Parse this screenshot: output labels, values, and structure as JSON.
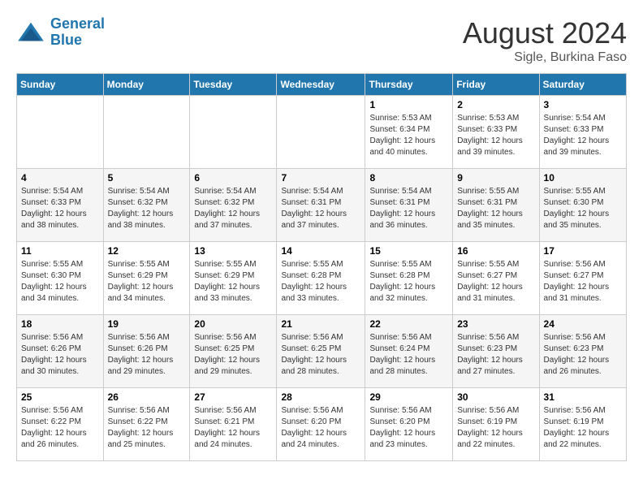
{
  "logo": {
    "line1": "General",
    "line2": "Blue"
  },
  "title": "August 2024",
  "subtitle": "Sigle, Burkina Faso",
  "weekdays": [
    "Sunday",
    "Monday",
    "Tuesday",
    "Wednesday",
    "Thursday",
    "Friday",
    "Saturday"
  ],
  "weeks": [
    [
      {
        "day": "",
        "info": ""
      },
      {
        "day": "",
        "info": ""
      },
      {
        "day": "",
        "info": ""
      },
      {
        "day": "",
        "info": ""
      },
      {
        "day": "1",
        "info": "Sunrise: 5:53 AM\nSunset: 6:34 PM\nDaylight: 12 hours\nand 40 minutes."
      },
      {
        "day": "2",
        "info": "Sunrise: 5:53 AM\nSunset: 6:33 PM\nDaylight: 12 hours\nand 39 minutes."
      },
      {
        "day": "3",
        "info": "Sunrise: 5:54 AM\nSunset: 6:33 PM\nDaylight: 12 hours\nand 39 minutes."
      }
    ],
    [
      {
        "day": "4",
        "info": "Sunrise: 5:54 AM\nSunset: 6:33 PM\nDaylight: 12 hours\nand 38 minutes."
      },
      {
        "day": "5",
        "info": "Sunrise: 5:54 AM\nSunset: 6:32 PM\nDaylight: 12 hours\nand 38 minutes."
      },
      {
        "day": "6",
        "info": "Sunrise: 5:54 AM\nSunset: 6:32 PM\nDaylight: 12 hours\nand 37 minutes."
      },
      {
        "day": "7",
        "info": "Sunrise: 5:54 AM\nSunset: 6:31 PM\nDaylight: 12 hours\nand 37 minutes."
      },
      {
        "day": "8",
        "info": "Sunrise: 5:54 AM\nSunset: 6:31 PM\nDaylight: 12 hours\nand 36 minutes."
      },
      {
        "day": "9",
        "info": "Sunrise: 5:55 AM\nSunset: 6:31 PM\nDaylight: 12 hours\nand 35 minutes."
      },
      {
        "day": "10",
        "info": "Sunrise: 5:55 AM\nSunset: 6:30 PM\nDaylight: 12 hours\nand 35 minutes."
      }
    ],
    [
      {
        "day": "11",
        "info": "Sunrise: 5:55 AM\nSunset: 6:30 PM\nDaylight: 12 hours\nand 34 minutes."
      },
      {
        "day": "12",
        "info": "Sunrise: 5:55 AM\nSunset: 6:29 PM\nDaylight: 12 hours\nand 34 minutes."
      },
      {
        "day": "13",
        "info": "Sunrise: 5:55 AM\nSunset: 6:29 PM\nDaylight: 12 hours\nand 33 minutes."
      },
      {
        "day": "14",
        "info": "Sunrise: 5:55 AM\nSunset: 6:28 PM\nDaylight: 12 hours\nand 33 minutes."
      },
      {
        "day": "15",
        "info": "Sunrise: 5:55 AM\nSunset: 6:28 PM\nDaylight: 12 hours\nand 32 minutes."
      },
      {
        "day": "16",
        "info": "Sunrise: 5:55 AM\nSunset: 6:27 PM\nDaylight: 12 hours\nand 31 minutes."
      },
      {
        "day": "17",
        "info": "Sunrise: 5:56 AM\nSunset: 6:27 PM\nDaylight: 12 hours\nand 31 minutes."
      }
    ],
    [
      {
        "day": "18",
        "info": "Sunrise: 5:56 AM\nSunset: 6:26 PM\nDaylight: 12 hours\nand 30 minutes."
      },
      {
        "day": "19",
        "info": "Sunrise: 5:56 AM\nSunset: 6:26 PM\nDaylight: 12 hours\nand 29 minutes."
      },
      {
        "day": "20",
        "info": "Sunrise: 5:56 AM\nSunset: 6:25 PM\nDaylight: 12 hours\nand 29 minutes."
      },
      {
        "day": "21",
        "info": "Sunrise: 5:56 AM\nSunset: 6:25 PM\nDaylight: 12 hours\nand 28 minutes."
      },
      {
        "day": "22",
        "info": "Sunrise: 5:56 AM\nSunset: 6:24 PM\nDaylight: 12 hours\nand 28 minutes."
      },
      {
        "day": "23",
        "info": "Sunrise: 5:56 AM\nSunset: 6:23 PM\nDaylight: 12 hours\nand 27 minutes."
      },
      {
        "day": "24",
        "info": "Sunrise: 5:56 AM\nSunset: 6:23 PM\nDaylight: 12 hours\nand 26 minutes."
      }
    ],
    [
      {
        "day": "25",
        "info": "Sunrise: 5:56 AM\nSunset: 6:22 PM\nDaylight: 12 hours\nand 26 minutes."
      },
      {
        "day": "26",
        "info": "Sunrise: 5:56 AM\nSunset: 6:22 PM\nDaylight: 12 hours\nand 25 minutes."
      },
      {
        "day": "27",
        "info": "Sunrise: 5:56 AM\nSunset: 6:21 PM\nDaylight: 12 hours\nand 24 minutes."
      },
      {
        "day": "28",
        "info": "Sunrise: 5:56 AM\nSunset: 6:20 PM\nDaylight: 12 hours\nand 24 minutes."
      },
      {
        "day": "29",
        "info": "Sunrise: 5:56 AM\nSunset: 6:20 PM\nDaylight: 12 hours\nand 23 minutes."
      },
      {
        "day": "30",
        "info": "Sunrise: 5:56 AM\nSunset: 6:19 PM\nDaylight: 12 hours\nand 22 minutes."
      },
      {
        "day": "31",
        "info": "Sunrise: 5:56 AM\nSunset: 6:19 PM\nDaylight: 12 hours\nand 22 minutes."
      }
    ]
  ]
}
